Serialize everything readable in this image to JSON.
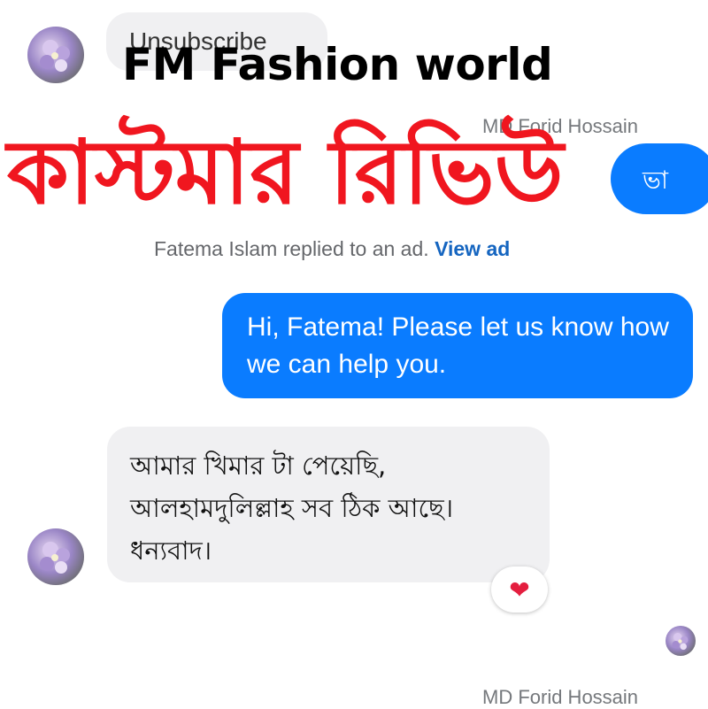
{
  "banner": {
    "unsubscribe_label": "Unsubscribe",
    "brand": "FM Fashion world",
    "headline": "কাস্টমার রিভিউ"
  },
  "chat": {
    "sender_name_top": "MD Forid Hossain",
    "sender_name_bottom": "MD Forid Hossain",
    "partial_bubble_text": "ভা",
    "reply_note": {
      "text": "Fatema Islam replied to an ad.",
      "link": "View ad"
    },
    "outgoing_message": "Hi, Fatema! Please let us know how we can help you.",
    "incoming_message": {
      "line1": "আমার খিমার টা পেয়েছি,",
      "line2": "আলহামদুলিল্লাহ সব ঠিক আছে।",
      "line3": "ধন্যবাদ।"
    },
    "reaction": "❤"
  },
  "colors": {
    "headline": "#f0161f",
    "outgoing_bubble": "#0a7cff",
    "incoming_bubble": "#f0f0f2",
    "link": "#1565c0"
  },
  "icons": [
    "avatar-flower-icon",
    "heart-reaction-icon"
  ]
}
